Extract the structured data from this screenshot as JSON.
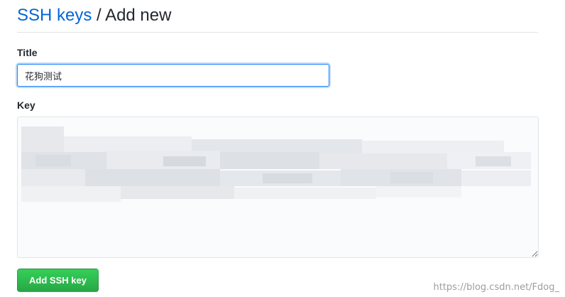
{
  "header": {
    "breadcrumb_link": "SSH keys",
    "separator": "/",
    "current_page": "Add new"
  },
  "form": {
    "title_label": "Title",
    "title_value": "花狗测试",
    "key_label": "Key",
    "key_value": "",
    "submit_label": "Add SSH key"
  },
  "watermark": "https://blog.csdn.net/Fdog_",
  "colors": {
    "link": "#0366d6",
    "primary_button": "#28a745",
    "focus_border": "#2188ff"
  }
}
